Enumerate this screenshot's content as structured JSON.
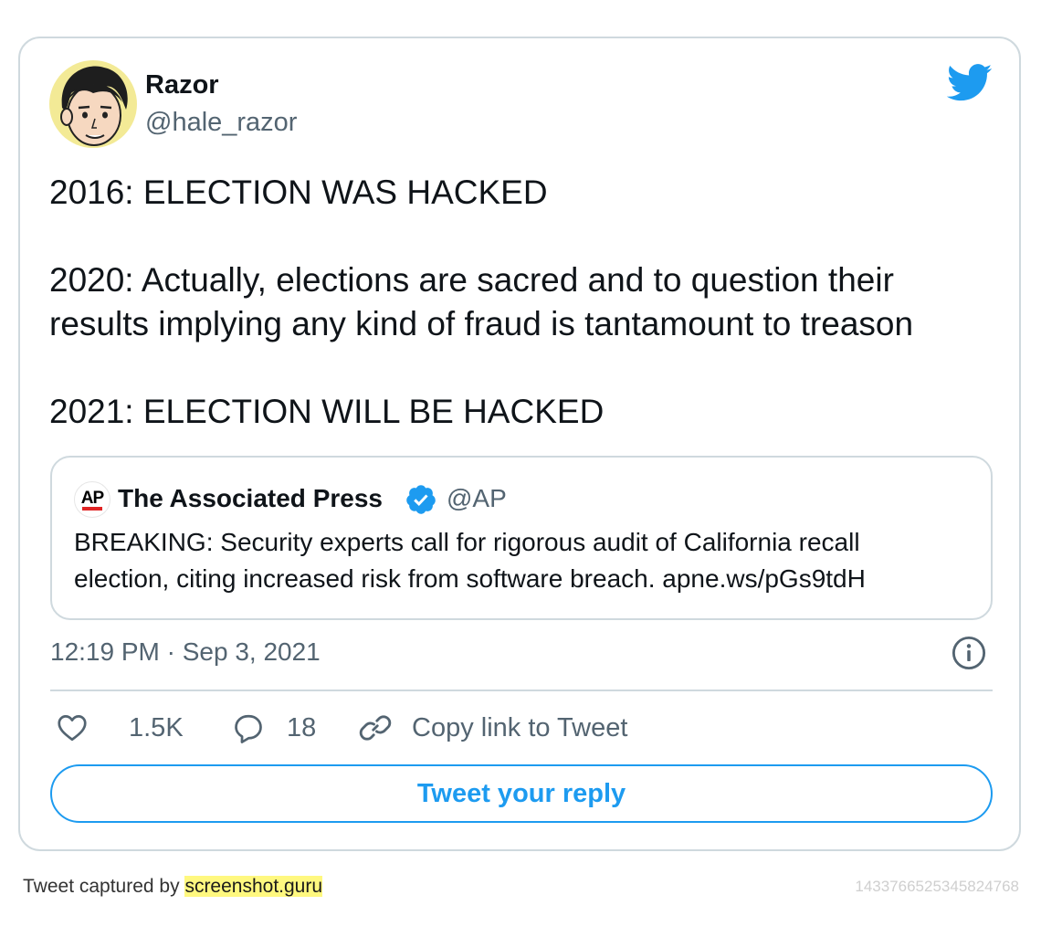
{
  "tweet": {
    "author_name": "Razor",
    "author_handle": "@hale_razor",
    "lines": [
      "2016: ELECTION WAS HACKED",
      "2020: Actually, elections are sacred and to question their",
      "results implying any kind of fraud is tantamount to treason",
      "2021: ELECTION WILL BE HACKED"
    ],
    "timestamp": "12:19 PM · Sep 3, 2021"
  },
  "quote": {
    "logo_text": "AP",
    "author_name": "The Associated Press",
    "author_handle": "@AP",
    "text_lines": [
      "BREAKING: Security experts call for rigorous audit of California recall",
      "election, citing increased risk from software breach. apne.ws/pGs9tdH"
    ]
  },
  "actions": {
    "likes": "1.5K",
    "replies": "18",
    "copy_link_label": "Copy link to Tweet"
  },
  "reply_button_label": "Tweet your reply",
  "footer": {
    "captured_by_label": "Tweet captured by ",
    "captured_by_site": "screenshot.guru",
    "tweet_id": "1433766525345824768"
  },
  "colors": {
    "brand_blue": "#1d9bf0",
    "text_primary": "#0f1419",
    "text_secondary": "#536471",
    "border": "#cfd9de",
    "highlight": "#fff87f"
  },
  "icons": [
    "twitter-bird-icon",
    "verified-badge-icon",
    "info-icon",
    "heart-icon",
    "reply-bubble-icon",
    "link-icon"
  ]
}
